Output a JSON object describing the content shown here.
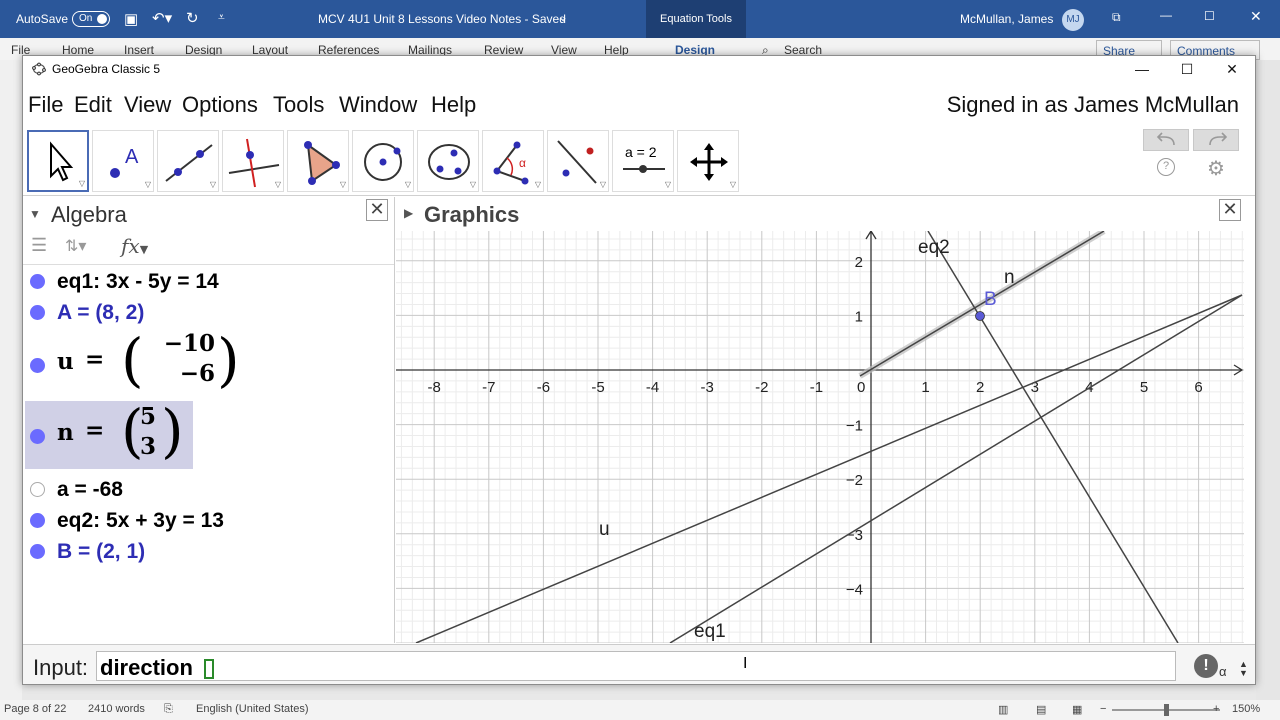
{
  "word": {
    "autosave_label": "AutoSave",
    "autosave_state": "On",
    "doc_title": "MCV 4U1 Unit 8 Lessons Video Notes  -  Saved",
    "context_tab": "Equation Tools",
    "user_name": "McMullan, James",
    "user_initials": "MJ",
    "ribbon_tabs": [
      "File",
      "Home",
      "Insert",
      "Design",
      "Layout",
      "References",
      "Mailings",
      "Review",
      "View",
      "Help",
      "Design"
    ],
    "search_label": "Search",
    "share_label": "Share",
    "comments_label": "Comments",
    "status": {
      "page": "Page 8 of 22",
      "words": "2410 words",
      "language": "English (United States)",
      "zoom": "150%"
    }
  },
  "geogebra": {
    "window_title": "GeoGebra Classic 5",
    "menus": [
      "File",
      "Edit",
      "View",
      "Options",
      "Tools",
      "Window",
      "Help"
    ],
    "signed_in": "Signed in as James McMullan",
    "tools": [
      {
        "name": "move",
        "active": true
      },
      {
        "name": "point",
        "active": false
      },
      {
        "name": "line",
        "active": false
      },
      {
        "name": "perpendicular-line",
        "active": false
      },
      {
        "name": "polygon",
        "active": false
      },
      {
        "name": "circle",
        "active": false
      },
      {
        "name": "conic",
        "active": false
      },
      {
        "name": "angle",
        "active": false
      },
      {
        "name": "reflect",
        "active": false
      },
      {
        "name": "slider",
        "active": false,
        "label": "a = 2"
      },
      {
        "name": "move-graphics",
        "active": false
      }
    ],
    "algebra": {
      "title": "Algebra",
      "fx_label": "fx",
      "rows": [
        {
          "text": "eq1: 3x - 5y = 14",
          "kind": "object",
          "shown": true
        },
        {
          "text": "A = (8, 2)",
          "kind": "point",
          "shown": true
        },
        {
          "name": "u",
          "vector": [
            "−10",
            "−6"
          ],
          "shown": true
        },
        {
          "name": "n",
          "vector": [
            "5",
            "3"
          ],
          "shown": true,
          "selected": true
        },
        {
          "text": "a = -68",
          "kind": "object",
          "shown": false
        },
        {
          "text": "eq2: 5x + 3y = 13",
          "kind": "object",
          "shown": true
        },
        {
          "text": "B = (2, 1)",
          "kind": "point",
          "shown": true
        }
      ]
    },
    "graphics": {
      "title": "Graphics",
      "x_ticks": [
        "-8",
        "-7",
        "-6",
        "-5",
        "-4",
        "-3",
        "-2",
        "-1",
        "0",
        "1",
        "2",
        "3",
        "4",
        "5",
        "6"
      ],
      "y_ticks": [
        "2",
        "1",
        "−1",
        "−2",
        "−3",
        "−4"
      ],
      "labels": {
        "eq2": "eq2",
        "n": "n",
        "B": "B",
        "u": "u",
        "eq1": "eq1"
      },
      "colors": {
        "grid_minor": "#ececec",
        "grid_major": "#c8c8c8",
        "line": "#444444",
        "point": "#5b5bd6",
        "point_label": "#5b5bd6"
      }
    },
    "input": {
      "label": "Input:",
      "value": "direction",
      "alpha_label": "α"
    }
  }
}
